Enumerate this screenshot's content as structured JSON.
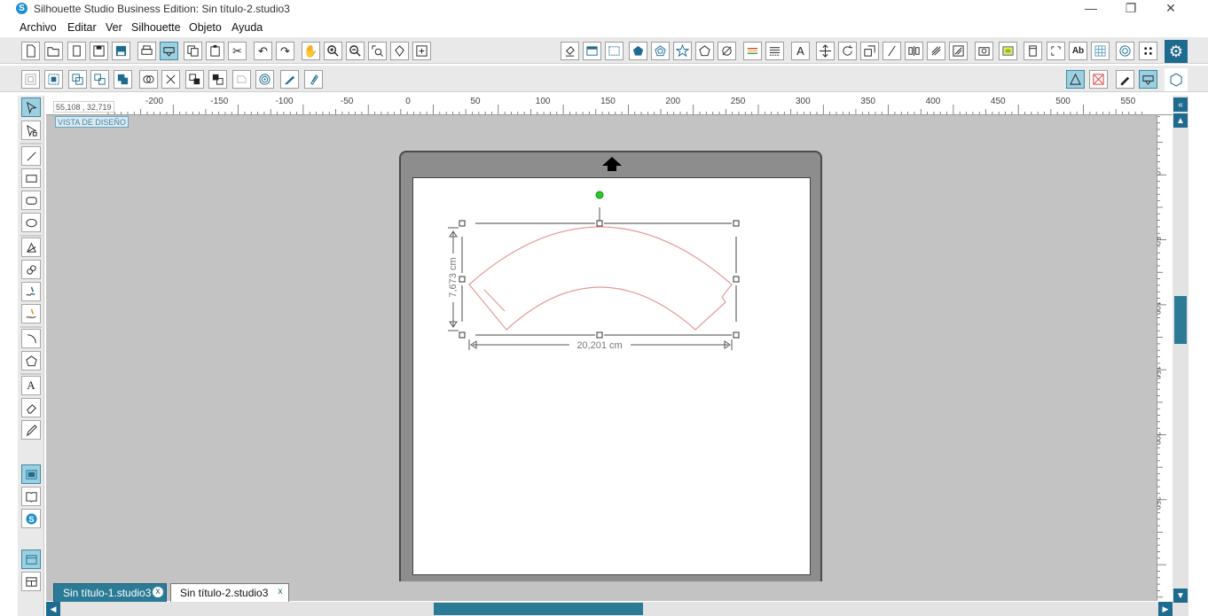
{
  "window": {
    "title": "Silhouette Studio Business Edition: Sin título-2.studio3",
    "minimize_glyph": "—",
    "restore_glyph": "❐",
    "close_glyph": "✕"
  },
  "menu": [
    "Archivo",
    "Editar",
    "Ver",
    "Silhouette",
    "Objeto",
    "Ayuda"
  ],
  "toolbar": {
    "text_tool_glyph": "A",
    "ab_glyph": "Ab"
  },
  "canvas": {
    "view_label": "VISTA DE DISEÑO",
    "cursor_coords": "55,108 , 32,719",
    "width_label": "20,201 cm",
    "height_label": "7,673 cm",
    "shape_color": "#e59a9a"
  },
  "ruler_top": [
    "-200",
    "-150",
    "-100",
    "-50",
    "0",
    "50",
    "100",
    "150",
    "200",
    "250",
    "300",
    "350",
    "400",
    "450",
    "500",
    "550"
  ],
  "ruler_left": [
    "50",
    "0",
    "50",
    "100",
    "150",
    "200",
    "250"
  ],
  "tabs": [
    {
      "label": "Sin título-1.studio3",
      "close": "x",
      "active": false
    },
    {
      "label": "Sin título-2.studio3",
      "close": "x",
      "active": true
    }
  ],
  "colors": {
    "accent": "#1f6b8f",
    "selection": "#9ccfe0",
    "canvas_bg": "#c3c3c3"
  }
}
